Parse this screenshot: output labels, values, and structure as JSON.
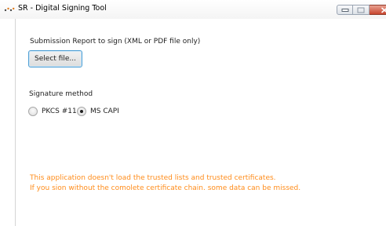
{
  "window": {
    "title": "SR - Digital Signing Tool",
    "icon": "app-logo-icon"
  },
  "submission": {
    "label": "Submission Report to sign (XML or PDF file only)",
    "select_button": "Select file..."
  },
  "signature": {
    "label": "Signature method",
    "options": [
      {
        "label": "PKCS #11",
        "selected": false
      },
      {
        "label": "MS CAPI",
        "selected": true
      }
    ]
  },
  "warning": {
    "line1": "This application doesn't load the trusted lists and trusted certificates.",
    "line2": "If you sion without the comolete certificate chain. some data can be missed.",
    "color": "#ff8c1a"
  },
  "colors": {
    "accent_border": "#4e9fd4",
    "close_button": "#c7462f"
  }
}
